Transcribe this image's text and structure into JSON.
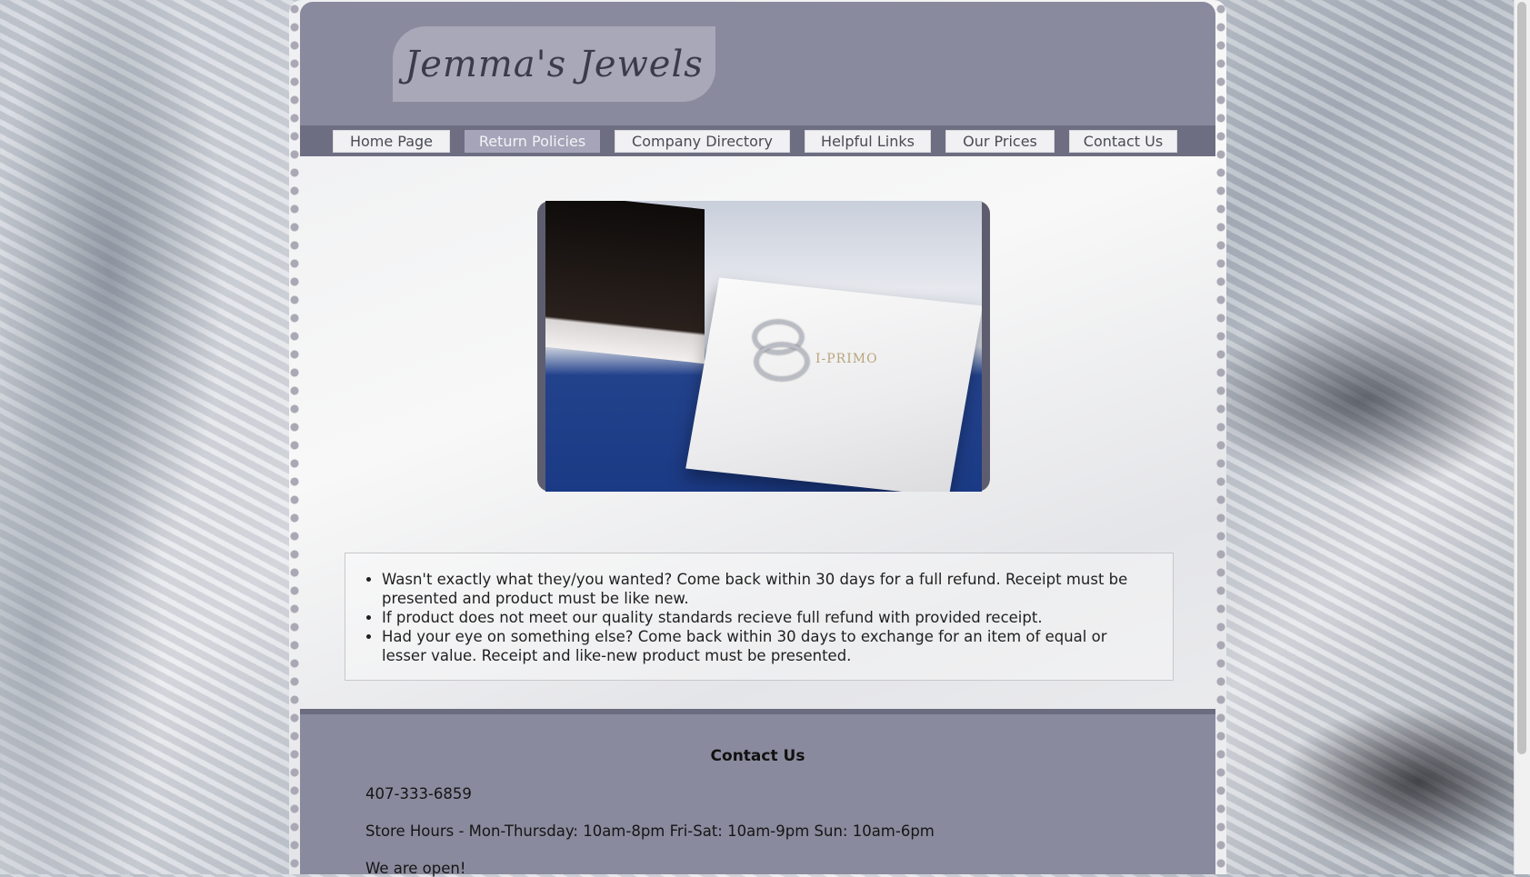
{
  "site": {
    "title": "Jemma's Jewels"
  },
  "nav": {
    "items": [
      {
        "label": "Home Page",
        "active": false
      },
      {
        "label": "Return Policies",
        "active": true
      },
      {
        "label": "Company Directory",
        "active": false
      },
      {
        "label": "Helpful Links",
        "active": false
      },
      {
        "label": "Our Prices",
        "active": false
      },
      {
        "label": "Contact Us",
        "active": false
      }
    ]
  },
  "hero": {
    "box_brand": "I-PRIMO"
  },
  "policies": {
    "items": [
      "Wasn't exactly what they/you wanted? Come back within 30 days for a full refund. Receipt must be presented and product must be like new.",
      "If product does not meet our quality standards recieve full refund with provided receipt.",
      "Had your eye on something else? Come back within 30 days to exchange for an item of equal or lesser value. Receipt and like-new product must be presented."
    ]
  },
  "footer": {
    "title": "Contact Us",
    "phone": "407-333-6859",
    "hours": "Store Hours - Mon-Thursday: 10am-8pm Fri-Sat: 10am-9pm Sun: 10am-6pm",
    "status": "We are open!"
  },
  "colors": {
    "header_bg": "#8a8a9e",
    "nav_bg": "#6e6e82",
    "active_tab": "#a5a4b8"
  }
}
